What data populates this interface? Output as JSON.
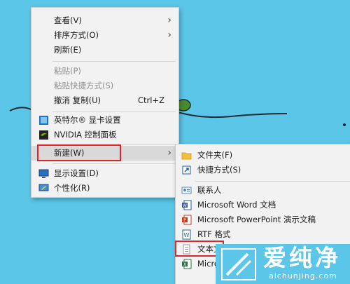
{
  "colors": {
    "desktop": "#5bc6e8",
    "menu_bg": "#f2f2f2",
    "highlight": "#d9d9d9",
    "disabled_text": "#8e8e8e",
    "annotation_red": "#e0242b",
    "watermark": "#ffffff"
  },
  "main_menu": {
    "view": "查看(V)",
    "sort_by": "排序方式(O)",
    "refresh": "刷新(E)",
    "paste": "粘贴(P)",
    "paste_shortcut": "粘贴快捷方式(S)",
    "undo_copy": "撤消 复制(U)",
    "undo_shortcut": "Ctrl+Z",
    "intel_graphics": "英特尔® 显卡设置",
    "nvidia_panel": "NVIDIA 控制面板",
    "new": "新建(W)",
    "display_settings": "显示设置(D)",
    "personalize": "个性化(R)"
  },
  "new_submenu": {
    "folder": "文件夹(F)",
    "shortcut": "快捷方式(S)",
    "contact": "联系人",
    "word": "Microsoft Word 文档",
    "powerpoint": "Microsoft PowerPoint 演示文稿",
    "rtf": "RTF 格式",
    "text_doc": "文本文",
    "excel": "Micro"
  },
  "icons": {
    "submenu_arrow": "chevron-right-icon",
    "intel": "intel-graphics-icon",
    "nvidia": "nvidia-icon",
    "display": "monitor-icon",
    "personalize": "personalize-icon",
    "folder": "folder-icon",
    "shortcut": "shortcut-icon",
    "contact": "contact-card-icon",
    "word": "word-doc-icon",
    "powerpoint": "powerpoint-icon",
    "rtf": "wordpad-icon",
    "text": "text-file-icon",
    "excel": "excel-icon"
  },
  "watermark": {
    "text": "爱纯净",
    "url": "aichunjing.com"
  }
}
